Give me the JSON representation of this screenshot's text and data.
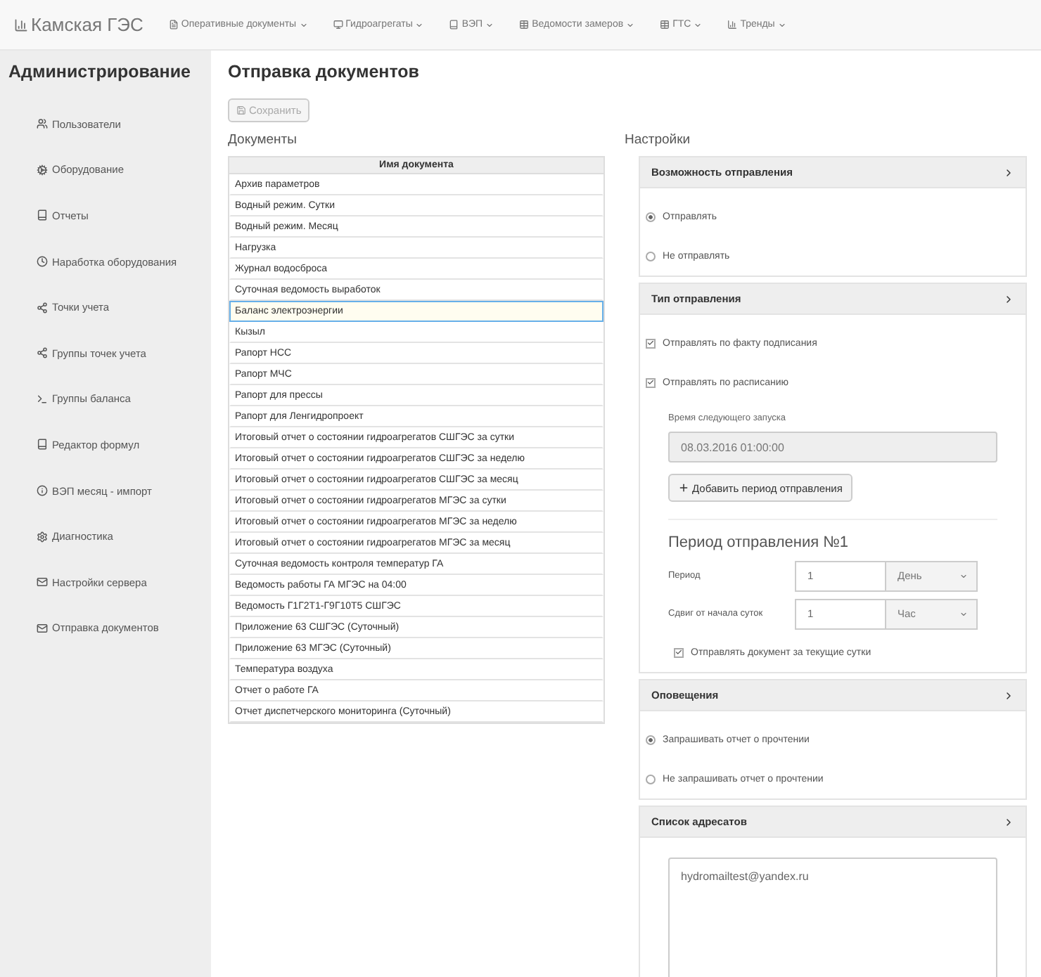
{
  "navbar": {
    "brand": "Камская ГЭС",
    "menus": [
      {
        "label": "Оперативные документы"
      },
      {
        "label": "Гидроагрегаты"
      },
      {
        "label": "ВЭП"
      },
      {
        "label": "Ведомости замеров"
      },
      {
        "label": "ГТС"
      },
      {
        "label": "Тренды"
      }
    ]
  },
  "sidebar": {
    "title": "Администрирование",
    "items": [
      {
        "label": "Пользователи"
      },
      {
        "label": "Оборудование"
      },
      {
        "label": "Отчеты"
      },
      {
        "label": "Наработка оборудования"
      },
      {
        "label": "Точки учета"
      },
      {
        "label": "Группы точек учета"
      },
      {
        "label": "Группы баланса"
      },
      {
        "label": "Редактор формул"
      },
      {
        "label": "ВЭП месяц - импорт"
      },
      {
        "label": "Диагностика"
      },
      {
        "label": "Настройки сервера"
      },
      {
        "label": "Отправка документов"
      }
    ]
  },
  "page_title": "Отправка документов",
  "save_button": {
    "label": "Сохранить",
    "disabled": true
  },
  "documents": {
    "title": "Документы",
    "column": "Имя документа",
    "rows": [
      {
        "name": "Архив параметров",
        "selected": false
      },
      {
        "name": "Водный режим. Сутки",
        "selected": false
      },
      {
        "name": "Водный режим. Месяц",
        "selected": false
      },
      {
        "name": "Нагрузка",
        "selected": false
      },
      {
        "name": "Журнал водосброса",
        "selected": false
      },
      {
        "name": "Суточная ведомость выработок",
        "selected": false
      },
      {
        "name": "Баланс электроэнергии",
        "selected": true
      },
      {
        "name": "Кызыл",
        "selected": false
      },
      {
        "name": "Рапорт НСС",
        "selected": false
      },
      {
        "name": "Рапорт МЧС",
        "selected": false
      },
      {
        "name": "Рапорт для прессы",
        "selected": false
      },
      {
        "name": "Рапорт для Ленгидропроект",
        "selected": false
      },
      {
        "name": "Итоговый отчет о состоянии гидроагрегатов СШГЭС за сутки",
        "selected": false
      },
      {
        "name": "Итоговый отчет о состоянии гидроагрегатов СШГЭС за неделю",
        "selected": false
      },
      {
        "name": "Итоговый отчет о состоянии гидроагрегатов СШГЭС за месяц",
        "selected": false
      },
      {
        "name": "Итоговый отчет о состоянии гидроагрегатов МГЭС за сутки",
        "selected": false
      },
      {
        "name": "Итоговый отчет о состоянии гидроагрегатов МГЭС за неделю",
        "selected": false
      },
      {
        "name": "Итоговый отчет о состоянии гидроагрегатов МГЭС за месяц",
        "selected": false
      },
      {
        "name": "Суточная ведомость контроля температур ГА",
        "selected": false
      },
      {
        "name": "Ведомость работы ГА МГЭС на 04:00",
        "selected": false
      },
      {
        "name": "Ведомость Г1Г2Т1-Г9Г10Т5 СШГЭС",
        "selected": false
      },
      {
        "name": "Приложение 63 СШГЭС (Суточный)",
        "selected": false
      },
      {
        "name": "Приложение 63 МГЭС (Суточный)",
        "selected": false
      },
      {
        "name": "Температура воздуха",
        "selected": false
      },
      {
        "name": "Отчет о работе ГА",
        "selected": false
      },
      {
        "name": "Отчет диспетчерского мониторинга (Суточный)",
        "selected": false
      }
    ]
  },
  "settings": {
    "title": "Настройки",
    "send_option": {
      "title": "Возможность отправления",
      "options": [
        {
          "label": "Отправлять",
          "selected": true
        },
        {
          "label": "Не отправлять",
          "selected": false
        }
      ]
    },
    "send_type": {
      "title": "Тип отправления",
      "checks": [
        {
          "label": "Отправлять по факту подписания",
          "checked": true
        },
        {
          "label": "Отправлять по расписанию",
          "checked": true
        }
      ],
      "next_run_label": "Время следующего запуска",
      "next_run_value": "08.03.2016 01:00:00",
      "add_button": "Добавить период отправления",
      "period": {
        "title": "Период отправления №1",
        "rows": [
          {
            "label": "Период",
            "value": "1",
            "unit": "День"
          },
          {
            "label": "Сдвиг от начала суток",
            "value": "1",
            "unit": "Час"
          }
        ],
        "current_day": {
          "label": "Отправлять документ за текущие сутки",
          "checked": true
        }
      }
    },
    "notifications": {
      "title": "Оповещения",
      "options": [
        {
          "label": "Запрашивать отчет о прочтении",
          "selected": true
        },
        {
          "label": "Не запрашивать отчет о прочтении",
          "selected": false
        }
      ]
    },
    "recipients": {
      "title": "Список адресатов",
      "value": "hydromailtest@yandex.ru"
    }
  }
}
